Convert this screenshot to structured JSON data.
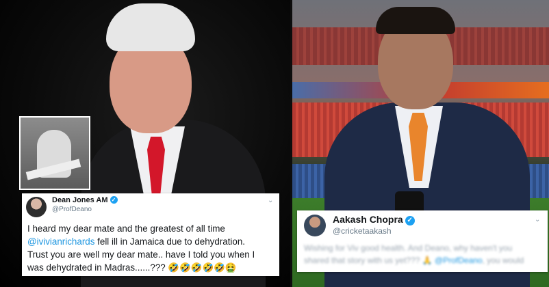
{
  "tweet_left": {
    "name": "Dean Jones AM",
    "handle": "@ProfDeano",
    "line1": "I heard my dear mate and the greatest of all time",
    "mention": "@ivivianrichards",
    "line2_rest": " fell ill in Jamaica due to dehydration.",
    "line3": "Trust you are well my dear mate.. have I told you when I",
    "line4": "was dehydrated in Madras......??? 🤣🤣🤣🤣🤣🤮"
  },
  "tweet_right": {
    "name": "Aakash Chopra",
    "handle": "@cricketaakash",
    "blurred_line1": "Wishing for Viv good health. And Deano, why haven't you",
    "blurred_line2": "shared that story with us yet??? 🙏",
    "blurred_mention": "@ProfDeano",
    "blurred_line2_end": ", you would"
  },
  "colors": {
    "tie_left": "#d3172a",
    "tie_right": "#e9852c",
    "verified": "#1da1f2",
    "mention": "#1b95e0"
  },
  "icons": [
    "verified-badge-icon",
    "chevron-down-icon"
  ]
}
